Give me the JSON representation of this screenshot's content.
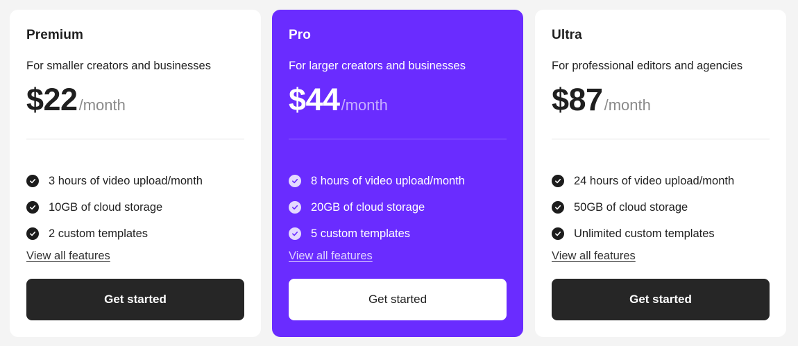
{
  "colors": {
    "page_background": "#f4f4f4",
    "card_background": "#ffffff",
    "featured_background": "#6a2cff",
    "button_dark": "#262626",
    "text_dark": "#1f1f1f",
    "text_muted": "#8a8a8a"
  },
  "plans": [
    {
      "name": "Premium",
      "description": "For smaller creators and businesses",
      "price": "$22",
      "period": "/month",
      "features": [
        "3 hours of video upload/month",
        "10GB of cloud storage",
        "2 custom templates"
      ],
      "feature_icon": "check-circle-icon",
      "view_link": "View all features",
      "cta": "Get started"
    },
    {
      "name": "Pro",
      "description": "For larger creators and businesses",
      "price": "$44",
      "period": "/month",
      "features": [
        "8 hours of video upload/month",
        "20GB of cloud storage",
        "5 custom templates"
      ],
      "feature_icon": "check-circle-icon",
      "view_link": "View all features",
      "cta": "Get started"
    },
    {
      "name": "Ultra",
      "description": "For professional editors and agencies",
      "price": "$87",
      "period": "/month",
      "features": [
        "24 hours of video upload/month",
        "50GB of cloud storage",
        "Unlimited custom templates"
      ],
      "feature_icon": "check-circle-icon",
      "view_link": "View all features",
      "cta": "Get started"
    }
  ]
}
